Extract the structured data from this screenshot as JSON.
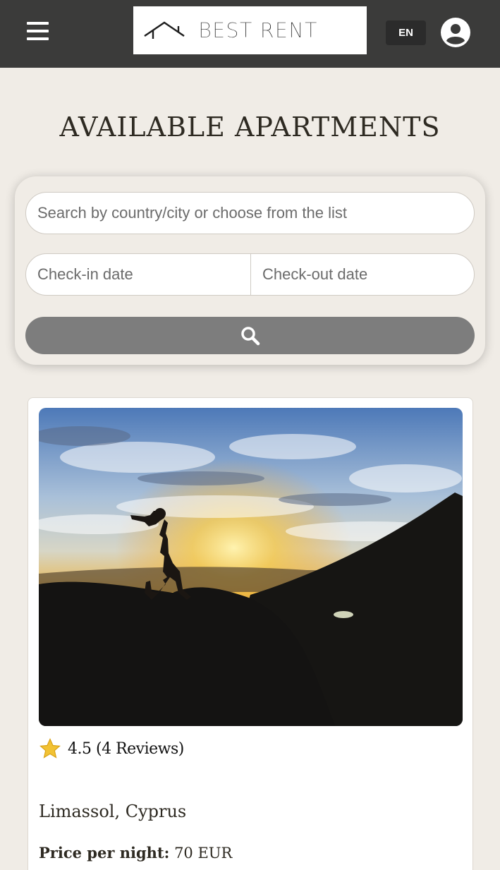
{
  "header": {
    "logo_text": "BEST RENT",
    "language": "EN",
    "menu_icon": "hamburger-menu-icon",
    "profile_icon": "user-circle-icon"
  },
  "page": {
    "title": "AVAILABLE APARTMENTS"
  },
  "search": {
    "location_placeholder": "Search by country/city or choose from the list",
    "checkin_placeholder": "Check-in date",
    "checkout_placeholder": "Check-out date",
    "search_icon": "search-icon"
  },
  "listings": [
    {
      "rating": "4.5",
      "reviews": "(4 Reviews)",
      "location": "Limassol, Cyprus",
      "price_label": "Price per night:",
      "price_value": "70 EUR"
    }
  ],
  "colors": {
    "header_bg": "#3b3b3a",
    "page_bg": "#f0ece6",
    "search_button": "#7d7d7d",
    "star": "#f2c233"
  }
}
